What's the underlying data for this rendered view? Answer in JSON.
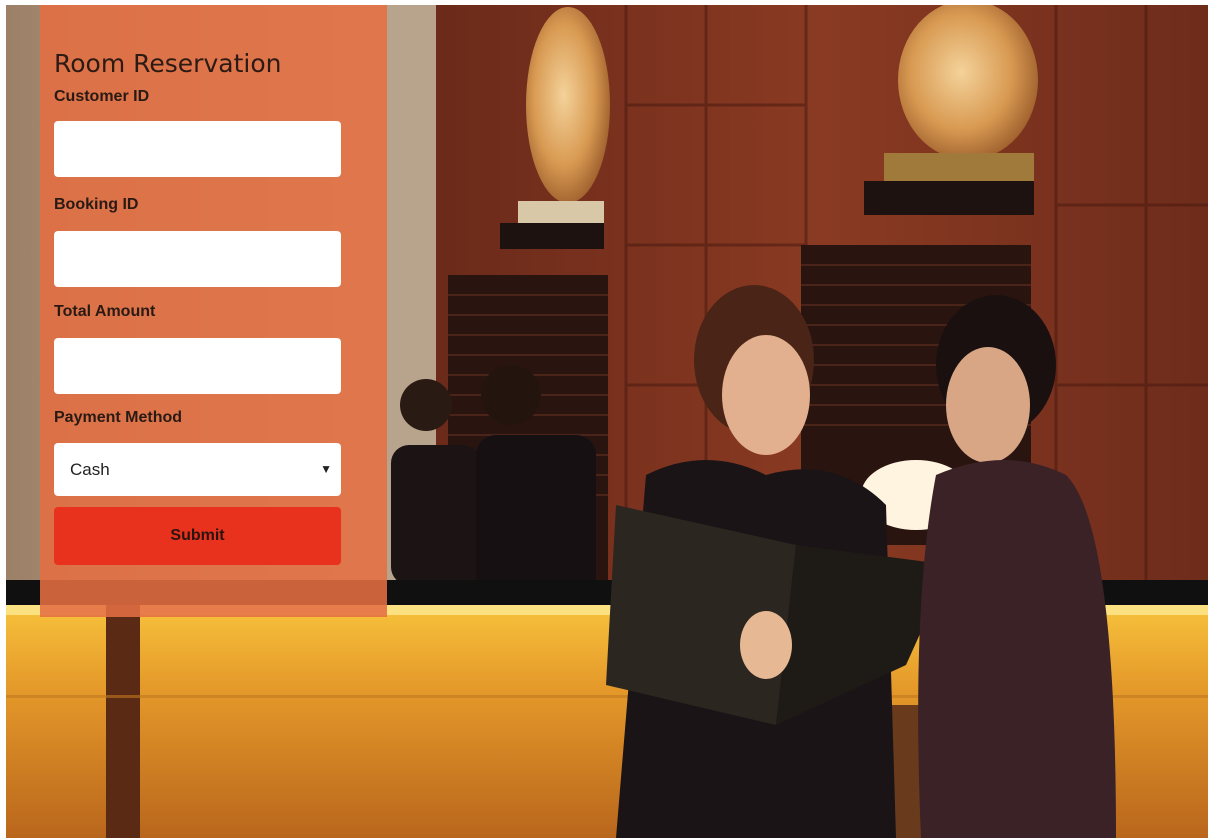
{
  "form": {
    "title": "Room Reservation",
    "customer_id": {
      "label": "Customer ID",
      "value": "",
      "placeholder": ""
    },
    "booking_id": {
      "label": "Booking ID",
      "value": "",
      "placeholder": ""
    },
    "total_amount": {
      "label": "Total Amount",
      "value": "",
      "placeholder": ""
    },
    "payment_method": {
      "label": "Payment Method",
      "selected": "Cash"
    },
    "submit_label": "Submit"
  },
  "background": {
    "icon": "hotel-reception-photo"
  }
}
